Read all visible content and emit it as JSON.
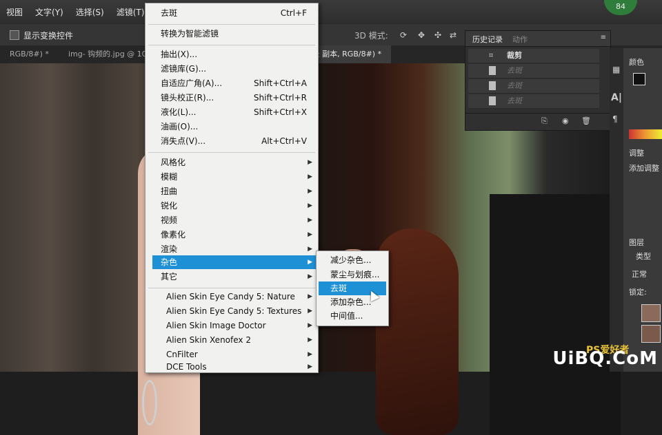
{
  "menubar": {
    "items": [
      "视图",
      "文字(Y)",
      "选择(S)",
      "滤镜(T)"
    ]
  },
  "options": {
    "show_transform": "显示变换控件",
    "mode_3d": "3D 模式:"
  },
  "tabs": [
    {
      "label": "RGB/8#) *"
    },
    {
      "label": "img- 钩频的.jpg @ 10"
    },
    {
      "label": "景 副本, RGB/8#) *"
    }
  ],
  "filter_menu": {
    "items": [
      {
        "label": "去斑",
        "shortcut": "Ctrl+F"
      },
      {
        "label": "转换为智能滤镜"
      },
      {
        "label": "抽出(X)..."
      },
      {
        "label": "滤镜库(G)..."
      },
      {
        "label": "自适应广角(A)...",
        "shortcut": "Shift+Ctrl+A"
      },
      {
        "label": "镜头校正(R)...",
        "shortcut": "Shift+Ctrl+R"
      },
      {
        "label": "液化(L)...",
        "shortcut": "Shift+Ctrl+X"
      },
      {
        "label": "油画(O)..."
      },
      {
        "label": "消失点(V)...",
        "shortcut": "Alt+Ctrl+V"
      },
      {
        "label": "风格化"
      },
      {
        "label": "模糊"
      },
      {
        "label": "扭曲"
      },
      {
        "label": "锐化"
      },
      {
        "label": "视频"
      },
      {
        "label": "像素化"
      },
      {
        "label": "渲染"
      },
      {
        "label": "杂色"
      },
      {
        "label": "其它"
      },
      {
        "label": "Alien Skin Eye Candy 5: Nature"
      },
      {
        "label": "Alien Skin Eye Candy 5: Textures"
      },
      {
        "label": "Alien Skin Image Doctor"
      },
      {
        "label": "Alien Skin Xenofex 2"
      },
      {
        "label": "CnFilter"
      },
      {
        "label": "DCE Tools"
      }
    ]
  },
  "noise_submenu": {
    "items": [
      "减少杂色...",
      "蒙尘与划痕...",
      "去斑",
      "添加杂色...",
      "中间值..."
    ]
  },
  "history": {
    "tab_history": "历史记录",
    "tab_actions": "动作",
    "rows": [
      "裁剪",
      "去斑",
      "去斑",
      "去斑"
    ]
  },
  "right_panels": {
    "color_tab": "颜色",
    "adjust_tab": "调整",
    "add_adjust": "添加调整",
    "layers_tab": "图层",
    "kind": "类型",
    "blend": "正常",
    "lock": "锁定:"
  },
  "badge": "84",
  "watermark": "UiBQ.CoM",
  "watermark_top": "PS爱好者"
}
